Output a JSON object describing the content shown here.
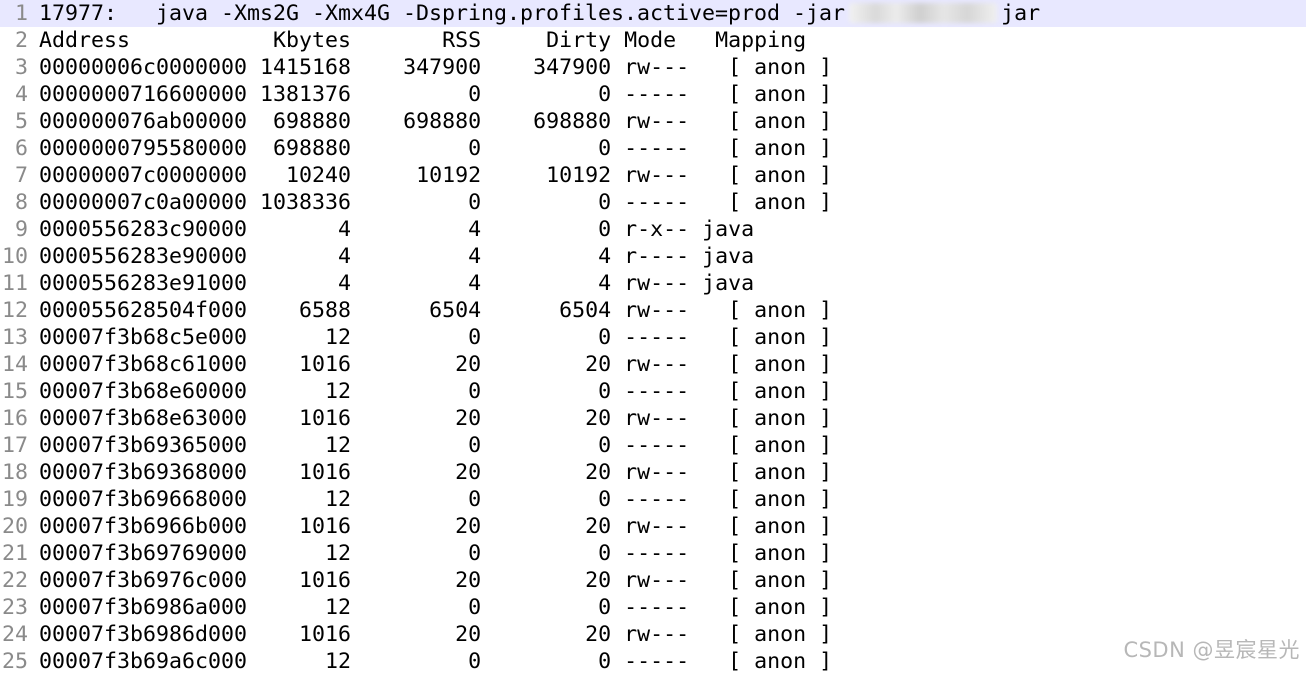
{
  "command": {
    "pid": "17977:",
    "args": "java -Xms2G -Xmx4G -Dspring.profiles.active=prod -jar",
    "jar_suffix": "jar"
  },
  "header": [
    "Address",
    "Kbytes",
    "RSS",
    "Dirty",
    "Mode",
    "Mapping"
  ],
  "rows": [
    [
      "00000006c0000000",
      "1415168",
      "347900",
      "347900",
      "rw---",
      "[ anon ]"
    ],
    [
      "0000000716600000",
      "1381376",
      "0",
      "0",
      "-----",
      "[ anon ]"
    ],
    [
      "000000076ab00000",
      "698880",
      "698880",
      "698880",
      "rw---",
      "[ anon ]"
    ],
    [
      "0000000795580000",
      "698880",
      "0",
      "0",
      "-----",
      "[ anon ]"
    ],
    [
      "00000007c0000000",
      "10240",
      "10192",
      "10192",
      "rw---",
      "[ anon ]"
    ],
    [
      "00000007c0a00000",
      "1038336",
      "0",
      "0",
      "-----",
      "[ anon ]"
    ],
    [
      "0000556283c90000",
      "4",
      "4",
      "0",
      "r-x--",
      "java"
    ],
    [
      "0000556283e90000",
      "4",
      "4",
      "4",
      "r----",
      "java"
    ],
    [
      "0000556283e91000",
      "4",
      "4",
      "4",
      "rw---",
      "java"
    ],
    [
      "000055628504f000",
      "6588",
      "6504",
      "6504",
      "rw---",
      "[ anon ]"
    ],
    [
      "00007f3b68c5e000",
      "12",
      "0",
      "0",
      "-----",
      "[ anon ]"
    ],
    [
      "00007f3b68c61000",
      "1016",
      "20",
      "20",
      "rw---",
      "[ anon ]"
    ],
    [
      "00007f3b68e60000",
      "12",
      "0",
      "0",
      "-----",
      "[ anon ]"
    ],
    [
      "00007f3b68e63000",
      "1016",
      "20",
      "20",
      "rw---",
      "[ anon ]"
    ],
    [
      "00007f3b69365000",
      "12",
      "0",
      "0",
      "-----",
      "[ anon ]"
    ],
    [
      "00007f3b69368000",
      "1016",
      "20",
      "20",
      "rw---",
      "[ anon ]"
    ],
    [
      "00007f3b69668000",
      "12",
      "0",
      "0",
      "-----",
      "[ anon ]"
    ],
    [
      "00007f3b6966b000",
      "1016",
      "20",
      "20",
      "rw---",
      "[ anon ]"
    ],
    [
      "00007f3b69769000",
      "12",
      "0",
      "0",
      "-----",
      "[ anon ]"
    ],
    [
      "00007f3b6976c000",
      "1016",
      "20",
      "20",
      "rw---",
      "[ anon ]"
    ],
    [
      "00007f3b6986a000",
      "12",
      "0",
      "0",
      "-----",
      "[ anon ]"
    ],
    [
      "00007f3b6986d000",
      "1016",
      "20",
      "20",
      "rw---",
      "[ anon ]"
    ],
    [
      "00007f3b69a6c000",
      "12",
      "0",
      "0",
      "-----",
      "[ anon ]"
    ]
  ],
  "line_numbers": [
    "1",
    "2",
    "3",
    "4",
    "5",
    "6",
    "7",
    "8",
    "9",
    "10",
    "11",
    "12",
    "13",
    "14",
    "15",
    "16",
    "17",
    "18",
    "19",
    "20",
    "21",
    "22",
    "23",
    "24",
    "25"
  ],
  "watermark": "CSDN @昱宸星光",
  "colors": {
    "current_line": "#e8e8ff",
    "gutter_text": "#808080",
    "watermark": "#b7b7b7"
  }
}
